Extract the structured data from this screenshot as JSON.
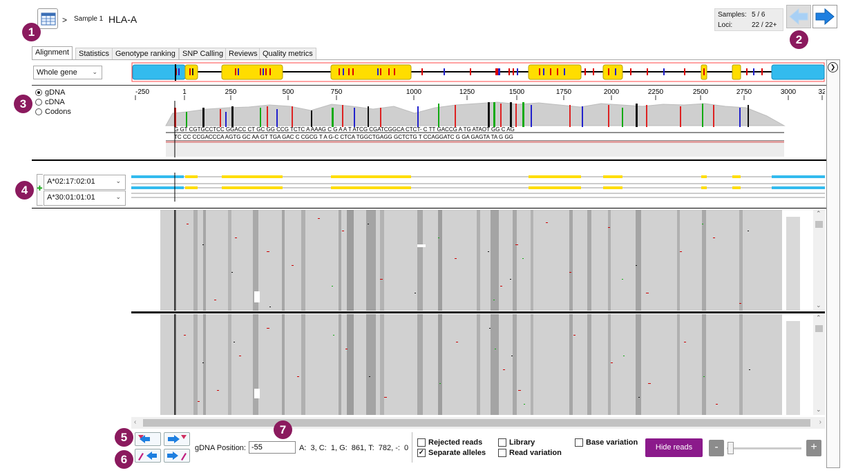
{
  "header": {
    "breadcrumb_sep": ">",
    "sample_label": "Sample 1",
    "locus_label": "HLA-A"
  },
  "counters": {
    "samples_label": "Samples:",
    "samples_value": "5 / 6",
    "loci_label": "Loci:",
    "loci_value": "22 / 22+"
  },
  "tabs": [
    {
      "label": "Alignment"
    },
    {
      "label": "Statistics"
    },
    {
      "label": "Genotype ranking"
    },
    {
      "label": "SNP Calling"
    },
    {
      "label": "Reviews"
    },
    {
      "label": "Quality metrics"
    }
  ],
  "region_select": {
    "value": "Whole gene"
  },
  "coordinate_mode": {
    "options": [
      "gDNA",
      "cDNA",
      "Codons"
    ],
    "selected": "gDNA"
  },
  "axis_ticks": [
    "-250",
    "1",
    "250",
    "500",
    "750",
    "1000",
    "1250",
    "1500",
    "1750",
    "2000",
    "2250",
    "2500",
    "2750",
    "3000",
    "32"
  ],
  "alleles": [
    {
      "value": "A*02:17:02:01"
    },
    {
      "value": "A*30:01:01:01"
    }
  ],
  "position": {
    "label": "gDNA Position:",
    "value": "-55",
    "counts": "A:  3, C:  1, G:  861, T:  782, -:  0"
  },
  "options": {
    "rejected_reads": {
      "label": "Rejected reads",
      "checked": false
    },
    "separate_alleles": {
      "label": "Separate alleles",
      "checked": true
    },
    "library": {
      "label": "Library",
      "checked": false
    },
    "read_variation": {
      "label": "Read variation",
      "checked": false
    },
    "base_variation": {
      "label": "Base variation",
      "checked": false
    }
  },
  "hide_reads_label": "Hide reads",
  "zoom": {
    "minus": "-",
    "plus": "+"
  },
  "badges": [
    "1",
    "2",
    "3",
    "4",
    "5",
    "6",
    "7"
  ],
  "colors": {
    "exon": "#ffdd00",
    "utr": "#33bbee",
    "accent_purple": "#8b1a8b",
    "badge": "#8b1a5e",
    "nav_arrow": "#1e7fe0"
  },
  "icons": {
    "table": "table-icon",
    "prev": "arrow-left-icon",
    "next": "arrow-right-icon",
    "collapse": "chevron-right-circle-icon"
  }
}
